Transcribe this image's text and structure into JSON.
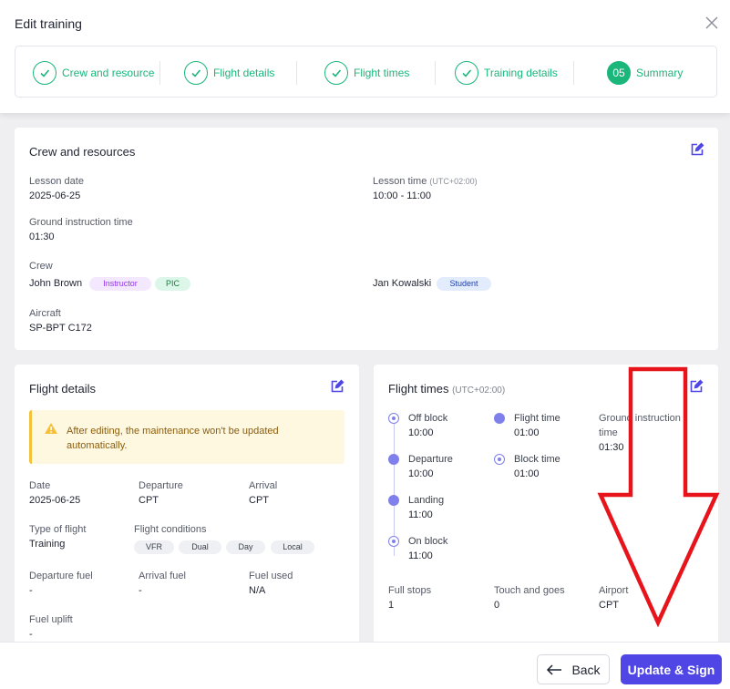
{
  "dialog": {
    "title": "Edit training"
  },
  "steps": [
    {
      "label": "Crew and resource",
      "status": "done"
    },
    {
      "label": "Flight details",
      "status": "done"
    },
    {
      "label": "Flight times",
      "status": "done"
    },
    {
      "label": "Training details",
      "status": "done"
    },
    {
      "label": "Summary",
      "status": "active",
      "number": "05"
    }
  ],
  "crew_section": {
    "title": "Crew and resources",
    "lesson_date_label": "Lesson date",
    "lesson_date": "2025-06-25",
    "lesson_time_label": "Lesson time",
    "lesson_time_tz": "(UTC+02:00)",
    "lesson_time": "10:00 - 11:00",
    "ground_label": "Ground instruction time",
    "ground_value": "01:30",
    "crew_label": "Crew",
    "crew": [
      {
        "name": "John Brown",
        "roles": [
          "Instructor",
          "PIC"
        ]
      },
      {
        "name": "Jan Kowalski",
        "roles": [
          "Student"
        ]
      }
    ],
    "aircraft_label": "Aircraft",
    "aircraft": "SP-BPT C172"
  },
  "flight_details": {
    "title": "Flight details",
    "warning": "After editing, the maintenance won't be updated automatically.",
    "date_label": "Date",
    "date": "2025-06-25",
    "departure_label": "Departure",
    "departure": "CPT",
    "arrival_label": "Arrival",
    "arrival": "CPT",
    "type_label": "Type of flight",
    "type": "Training",
    "conditions_label": "Flight conditions",
    "conditions": [
      "VFR",
      "Dual",
      "Day",
      "Local"
    ],
    "dep_fuel_label": "Departure fuel",
    "dep_fuel": "-",
    "arr_fuel_label": "Arrival fuel",
    "arr_fuel": "-",
    "fuel_used_label": "Fuel used",
    "fuel_used": "N/A",
    "uplift_label": "Fuel uplift",
    "uplift": "-"
  },
  "flight_times": {
    "title": "Flight times",
    "tz": "(UTC+02:00)",
    "timeline": [
      {
        "label": "Off block",
        "value": "10:00"
      },
      {
        "label": "Departure",
        "value": "10:00"
      },
      {
        "label": "Landing",
        "value": "11:00"
      },
      {
        "label": "On block",
        "value": "11:00"
      }
    ],
    "flight_time_label": "Flight time",
    "flight_time": "01:00",
    "block_time_label": "Block time",
    "block_time": "01:00",
    "ground_label_1": "Ground instruction",
    "ground_label_2": "time",
    "ground_value": "01:30",
    "full_stops_label": "Full stops",
    "full_stops": "1",
    "touch_label": "Touch and goes",
    "touch": "0",
    "airport_label": "Airport",
    "airport": "CPT"
  },
  "footer": {
    "back_label": "Back",
    "update_label": "Update & Sign"
  },
  "colors": {
    "accent": "#4f46e5",
    "success": "#1bb67a",
    "arrow": "#e8141b",
    "warning": "#f3c13a"
  }
}
